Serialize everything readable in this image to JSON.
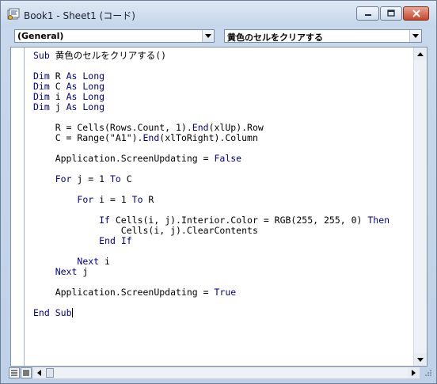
{
  "window": {
    "title": "Book1 - Sheet1 (コード)"
  },
  "object_dropdown": {
    "value": "(General)"
  },
  "procedure_dropdown": {
    "value": "黄色のセルをクリアする"
  },
  "code": {
    "lines": [
      "Sub 黄色のセルをクリアする()",
      "",
      "Dim R As Long",
      "Dim C As Long",
      "Dim i As Long",
      "Dim j As Long",
      "",
      "    R = Cells(Rows.Count, 1).End(xlUp).Row",
      "    C = Range(\"A1\").End(xlToRight).Column",
      "",
      "    Application.ScreenUpdating = False",
      "",
      "    For j = 1 To C",
      "",
      "        For i = 1 To R",
      "",
      "            If Cells(i, j).Interior.Color = RGB(255, 255, 0) Then",
      "                Cells(i, j).ClearContents",
      "            End If",
      "",
      "        Next i",
      "    Next j",
      "",
      "    Application.ScreenUpdating = True",
      "",
      "End Sub"
    ],
    "keyword_color": "#00008b"
  },
  "icons": {
    "app": "vba-module-icon",
    "minimize": "minimize-icon",
    "maximize": "maximize-icon",
    "close": "close-icon",
    "dropdown": "chevron-down-icon",
    "procedure_view": "procedure-view-icon",
    "full_module_view": "full-module-view-icon"
  }
}
